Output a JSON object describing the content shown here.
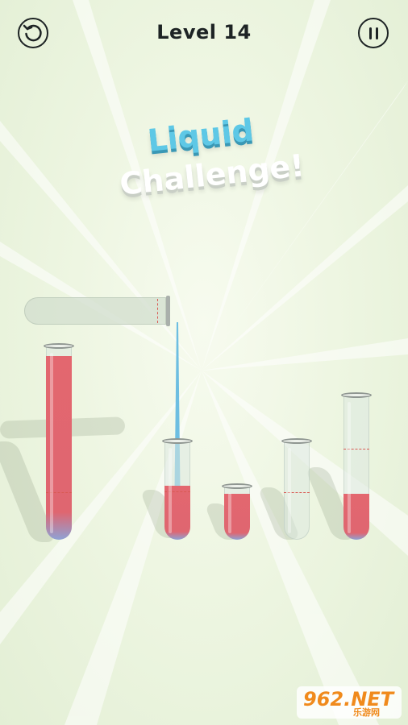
{
  "hud": {
    "level_label": "Level 14"
  },
  "title": {
    "line1": "Liquid",
    "line2": "Challenge!"
  },
  "tubes": [
    {
      "name": "tube-1",
      "fill": 0.95
    },
    {
      "name": "tube-2",
      "fill": 0.55
    },
    {
      "name": "tube-3",
      "fill": 0.86
    },
    {
      "name": "tube-4",
      "fill": 0.0
    },
    {
      "name": "tube-5",
      "fill": 0.32
    }
  ],
  "watermark": {
    "brand": "962.NET",
    "sub": "乐游网"
  },
  "colors": {
    "liquid": "#e3676f",
    "stream": "#5eb7e0",
    "accent_blue": "#5ec8e6"
  }
}
